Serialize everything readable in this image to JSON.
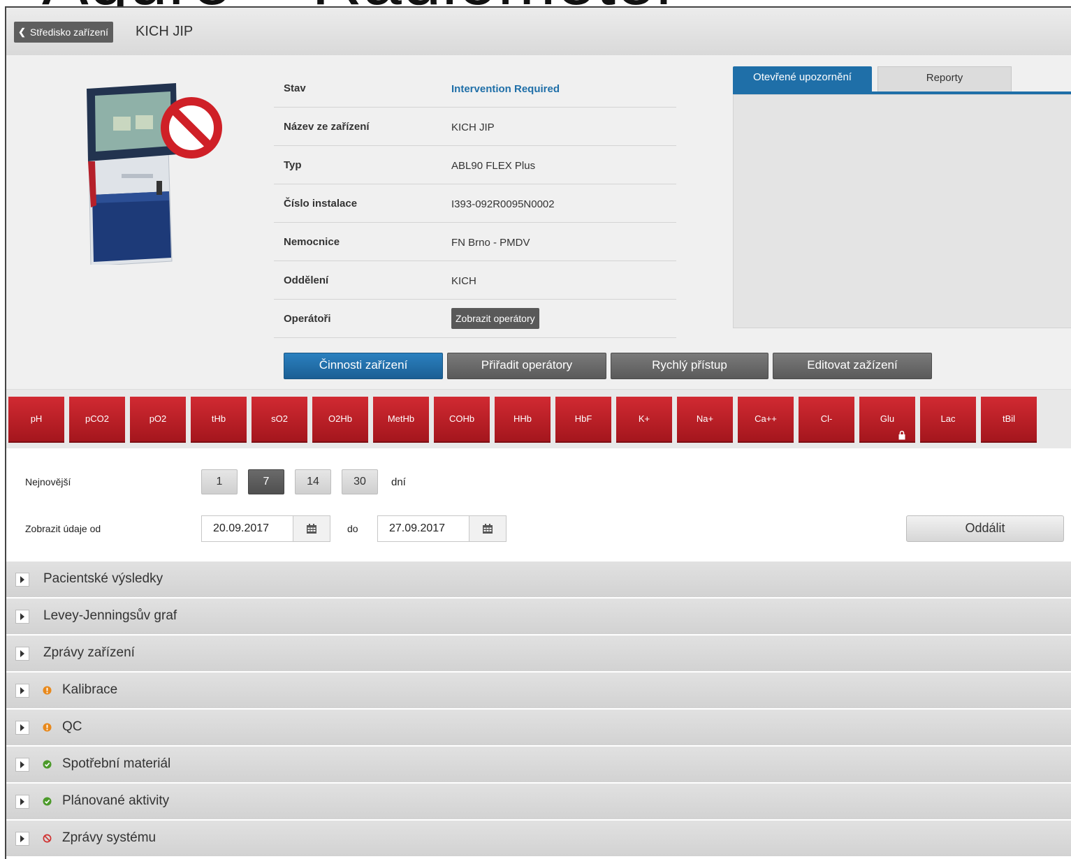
{
  "page_title": "Aqure – Radiometer",
  "header": {
    "back_label": "Středisko zařízení",
    "device_title": "KICH JIP"
  },
  "device_info": {
    "rows": [
      {
        "label": "Stav",
        "value": "Intervention Required"
      },
      {
        "label": "Název ze zařízení",
        "value": "KICH JIP"
      },
      {
        "label": "Typ",
        "value": "ABL90 FLEX Plus"
      },
      {
        "label": "Číslo instalace",
        "value": "I393-092R0095N0002"
      },
      {
        "label": "Nemocnice",
        "value": "FN Brno - PMDV"
      },
      {
        "label": "Oddělení",
        "value": "KICH"
      },
      {
        "label": "Operátoři",
        "value": ""
      }
    ],
    "show_operators_label": "Zobrazit operátory"
  },
  "tabs": {
    "alerts_label": "Otevřené upozornění",
    "reports_label": "Reporty"
  },
  "actions": {
    "device_activities": "Činnosti zařízení",
    "assign_operators": "Přiřadit operátory",
    "quick_access": "Rychlý přístup",
    "edit_device": "Editovat zažízení"
  },
  "parameters": [
    "pH",
    "pCO2",
    "pO2",
    "tHb",
    "sO2",
    "O2Hb",
    "MetHb",
    "COHb",
    "HHb",
    "HbF",
    "K+",
    "Na+",
    "Ca++",
    "Cl-",
    "Glu",
    "Lac",
    "tBil"
  ],
  "locked_parameter": "Glu",
  "filter": {
    "latest_label": "Nejnovější",
    "days": [
      "1",
      "7",
      "14",
      "30"
    ],
    "selected_days": "7",
    "days_unit": "dní",
    "show_from_label": "Zobrazit údaje od",
    "date_from": "20.09.2017",
    "to_label": "do",
    "date_to": "27.09.2017",
    "zoom_out_label": "Oddálit"
  },
  "sections": [
    {
      "label": "Pacientské výsledky",
      "status": "none"
    },
    {
      "label": "Levey-Jenningsův graf",
      "status": "none"
    },
    {
      "label": "Zprávy zařízení",
      "status": "none"
    },
    {
      "label": "Kalibrace",
      "status": "warning"
    },
    {
      "label": "QC",
      "status": "warning"
    },
    {
      "label": "Spotřební materiál",
      "status": "ok"
    },
    {
      "label": "Plánované aktivity",
      "status": "ok"
    },
    {
      "label": "Zprávy systému",
      "status": "blocked"
    }
  ],
  "colors": {
    "accent_blue": "#1f6fa8",
    "param_red": "#c0202a",
    "warning_orange": "#e8891c",
    "ok_green": "#4c9a2a",
    "blocked_red": "#d0302f"
  }
}
